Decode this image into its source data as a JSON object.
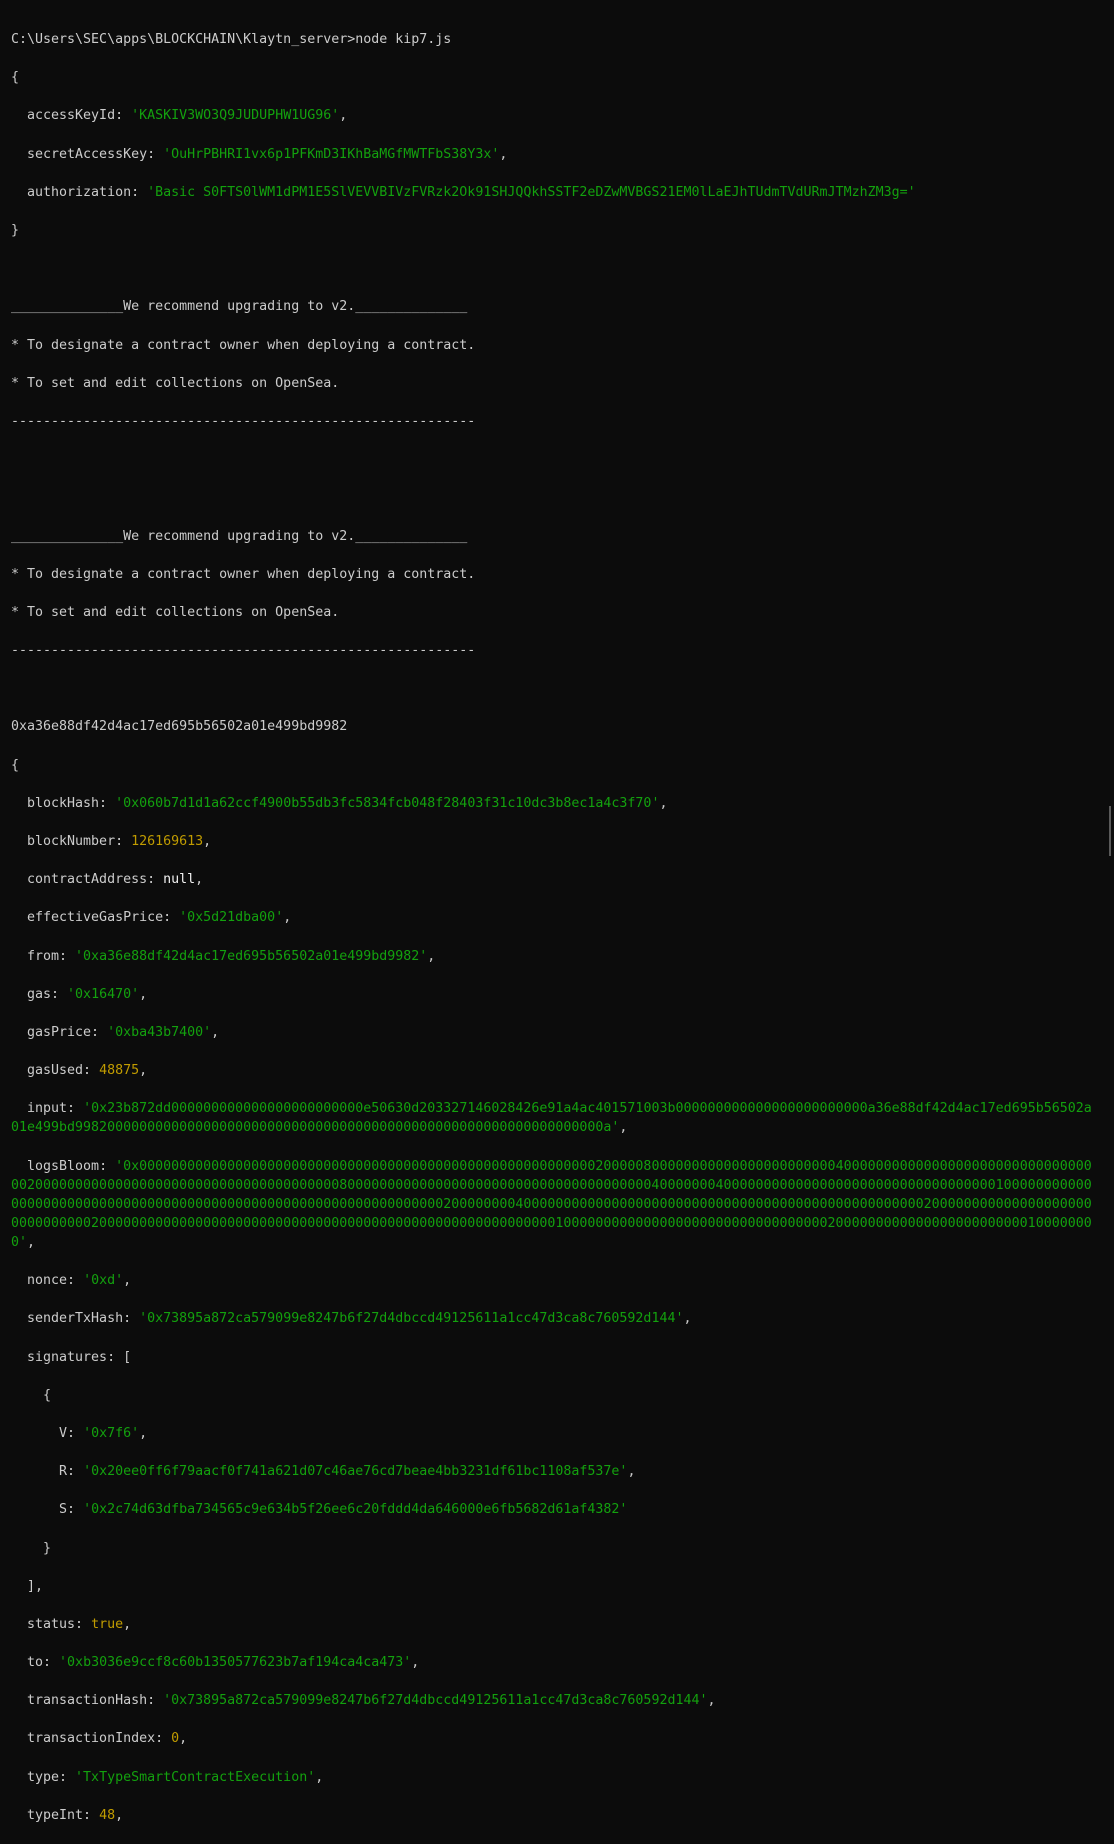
{
  "command": "C:\\Users\\SEC\\apps\\BLOCKCHAIN\\Klaytn_server>node kip7.js",
  "credentials": {
    "accessKeyId": "'KASKIV3WO3Q9JUDUPHW1UG96'",
    "secretAccessKey": "'OuHrPBHRI1vx6p1PFKmD3IKhBaMGfMWTFbS38Y3x'",
    "authorization": "'Basic S0FTS0lWM1dPM1E5SlVEVVBIVzFVRzk2Ok91SHJQQkhSSTF2eDZwMVBGS21EM0lLaEJhTUdmTVdURmJTMzhZM3g='"
  },
  "notice": {
    "header": "______________We recommend upgrading to v2.______________",
    "line1": "* To designate a contract owner when deploying a contract.",
    "line2": "* To set and edit collections on OpenSea.",
    "footer": "----------------------------------------------------------"
  },
  "address": "0xa36e88df42d4ac17ed695b56502a01e499bd9982",
  "receipt": {
    "blockHash": "'0x060b7d1d1a62ccf4900b55db3fc5834fcb048f28403f31c10dc3b8ec1a4c3f70'",
    "blockNumber": "126169613",
    "contractAddress": "null",
    "effectiveGasPrice": "'0x5d21dba00'",
    "from": "'0xa36e88df42d4ac17ed695b56502a01e499bd9982'",
    "gas": "'0x16470'",
    "gasPrice": "'0xba43b7400'",
    "gasUsed": "48875",
    "input": "'0x23b872dd000000000000000000000000e50630d203327146028426e91a4ac401571003b000000000000000000000000a36e88df42d4ac17ed695b56502a01e499bd998200000000000000000000000000000000000000000000000000000000000000a'",
    "logsBloom": "'0x000000000000000000000000000000000000000000000000000000000200000800000000000000000000000400000000000000000000000000000000020000000000000000000000000000000000000080000000000000000000000000000000000000040000000400000000000000000000000000000000001000000000000000000000000000000000000000000000000000000000000000002000000004000000000000000000000000000000000000000000000000002000000000000000000000000000000200000000000000000000000000000000000000000000000000000000010000000000000000000000000000000002000000000000000000000000100000000'",
    "nonce": "'0xd'",
    "senderTxHash": "'0x73895a872ca579099e8247b6f27d4dbccd49125611a1cc47d3ca8c760592d144'",
    "sig_V": "'0x7f6'",
    "sig_R": "'0x20ee0ff6f79aacf0f741a621d07c46ae76cd7beae4bb3231df61bc1108af537e'",
    "sig_S": "'0x2c74d63dfba734565c9e634b5f26ee6c20fddd4da646000e6fb5682d61af4382'",
    "status": "true",
    "to": "'0xb3036e9ccf8c60b1350577623b7af194ca4ca473'",
    "transactionHash": "'0x73895a872ca579099e8247b6f27d4dbccd49125611a1cc47d3ca8c760592d144'",
    "transactionIndex": "0",
    "type": "'TxTypeSmartContractExecution'",
    "typeInt": "48"
  },
  "colors": {
    "background": "#0c0c0c",
    "text": "#cccccc",
    "string": "#13a10e",
    "number": "#c19c00"
  }
}
